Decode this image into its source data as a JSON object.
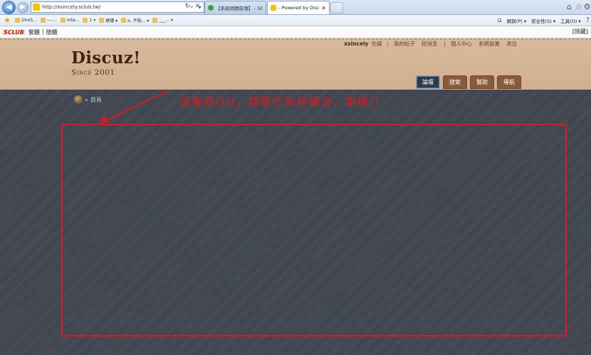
{
  "browser": {
    "url": "http://xsincely.sclub.tw/",
    "tabs": [
      {
        "title": "【系統問題區塊】 - SCLUB...",
        "active": false
      },
      {
        "title": "- Powered by Discuz!",
        "active": true
      }
    ],
    "favorites": [
      {
        "label": "OneS..."
      },
      {
        "label": "----..."
      },
      {
        "label": "Inte..."
      },
      {
        "label": "1 ▾"
      },
      {
        "label": "建議 ▾"
      },
      {
        "label": "o, 不能... ▾"
      },
      {
        "label": "___... ▾"
      }
    ],
    "commands": {
      "page": "網頁(P) ▾",
      "safety": "安全性(S) ▾",
      "tools": "工具(O) ▾"
    }
  },
  "toolbar": {
    "brand": "SCLUB",
    "simplified": "繁體",
    "separator": "|",
    "traditional": "簡體",
    "close_label": "[除藏]"
  },
  "header": {
    "username": "xsincely",
    "online_status": "在線",
    "links": [
      "我的帖子",
      "短消息",
      "個人中心",
      "系統設置",
      "退出"
    ],
    "logo_title": "Discuz!",
    "logo_subtitle": "Since 2001",
    "nav": [
      "論壇",
      "搜索",
      "幫助",
      "導航"
    ]
  },
  "breadcrumb": {
    "separator": "»",
    "home": "首頁"
  },
  "annotation": {
    "text": "這裏西QQ，請幫忙如何解決，謝謝!!",
    "color": "#e01818"
  }
}
